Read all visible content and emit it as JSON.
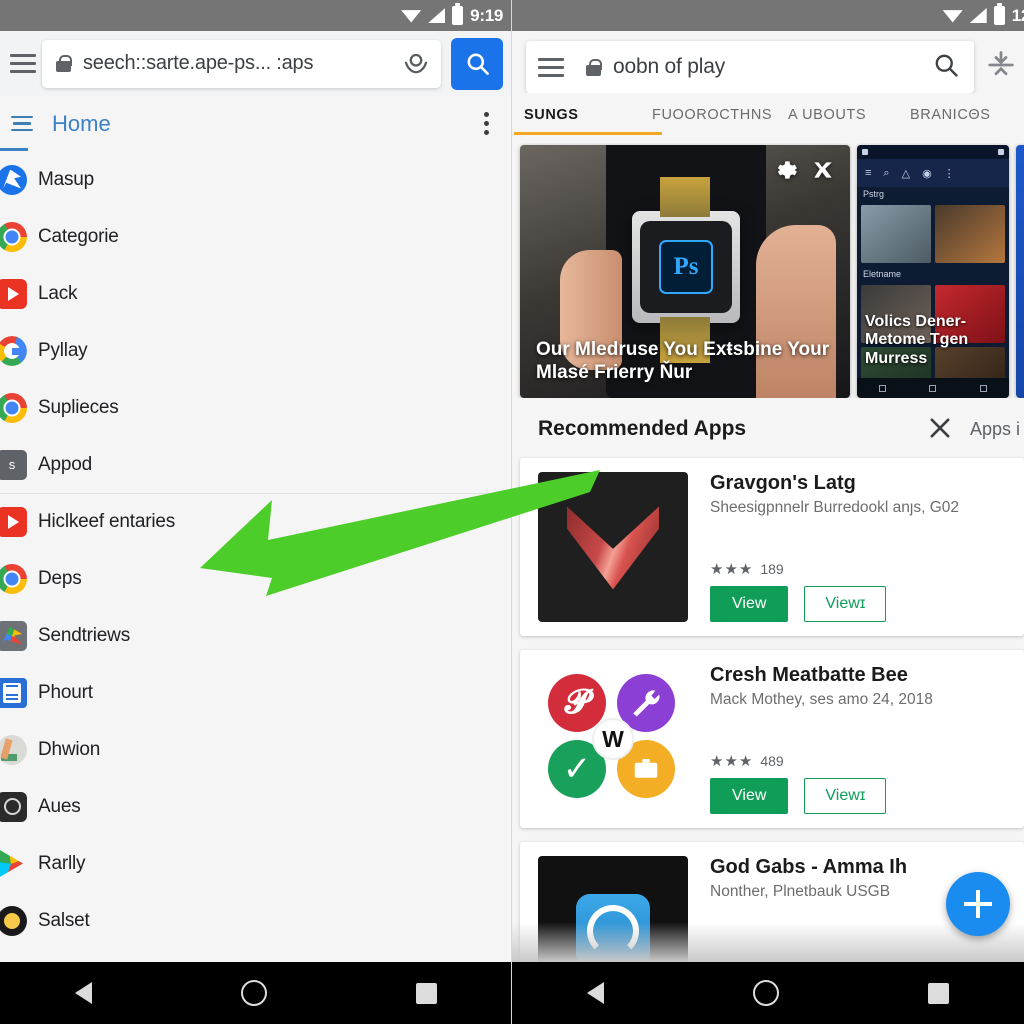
{
  "left": {
    "status": {
      "time": "9:19",
      "icons": [
        "wifi-icon",
        "signal-icon",
        "battery-icon"
      ]
    },
    "omnibox": {
      "url": "seech::sarte.ape-ps... :aps",
      "lock_icon": "lock-icon",
      "download_icon": "download-icon",
      "search_button_icon": "search-icon"
    },
    "home_header": {
      "title": "Home",
      "menu_icon": "hamburger-icon",
      "overflow_icon": "overflow-menu-icon"
    },
    "nav_items": [
      {
        "label": "Masup",
        "icon": "blue-circle-app-icon"
      },
      {
        "label": "Categorie",
        "icon": "chrome-icon"
      },
      {
        "label": "Lack",
        "icon": "youtube-icon"
      },
      {
        "label": "Pyllay",
        "icon": "google-g-icon"
      },
      {
        "label": "Suplieces",
        "icon": "chrome-icon"
      },
      {
        "label": "Appod",
        "icon": "gray-s-icon"
      },
      {
        "label": "Ηiclkeef entaries",
        "icon": "youtube-icon"
      },
      {
        "label": "Deps",
        "icon": "chrome-icon"
      },
      {
        "label": "Sendtriews",
        "icon": "photos-gray-icon"
      },
      {
        "label": "Phourt",
        "icon": "news-icon"
      },
      {
        "label": "Dhwion",
        "icon": "pale-circle-icon"
      },
      {
        "label": "Aues",
        "icon": "dark-square-icon"
      },
      {
        "label": "Rarlly",
        "icon": "play-store-icon"
      },
      {
        "label": "Salset",
        "icon": "black-ring-icon"
      }
    ]
  },
  "right": {
    "status": {
      "time": "12",
      "icons": [
        "wifi-icon",
        "signal-icon",
        "battery-icon"
      ]
    },
    "searchbar": {
      "query": "oobn of play",
      "menu_icon": "hamburger-icon",
      "lock_icon": "lock-icon",
      "search_icon": "search-icon",
      "trailing_icon": "collapse-icon"
    },
    "tabs": [
      {
        "label": "SUNGS",
        "active": true
      },
      {
        "label": "FUOOROCTHNS",
        "active": false
      },
      {
        "label": "A UBOUTS",
        "active": false
      },
      {
        "label": "BRANICΘS",
        "active": false
      }
    ],
    "carousel": [
      {
        "caption": "Our Mledruse You Exŧsbine Your Mlasé Frierry Ňur",
        "badge_icons": [
          "gear-icon",
          "shuffle-icon"
        ],
        "app_logo_text": "Ps"
      },
      {
        "caption": "Volics Dener- Metome Tgen Murress",
        "header_label": "Pstrg",
        "section_label": "Eletname"
      }
    ],
    "recommended": {
      "title": "Recommended Apps",
      "close_icon": "close-icon",
      "right_label": "Apps i"
    },
    "apps": [
      {
        "name": "Gravgon's Latg",
        "subtitle": "Sheesigpnnelr Burredookl anȷs, G02",
        "stars": "★★★",
        "rating_count": "189",
        "primary_button": "View",
        "secondary_button": "Viewɪ",
        "thumb": "dark-chevron-icon"
      },
      {
        "name": "Cresh Meatbatte Bee",
        "subtitle": "Mack Mothey, ses amo 24, 2018",
        "stars": "★★★",
        "rating_count": "489",
        "primary_button": "View",
        "secondary_button": "Viewɪ",
        "thumb": "four-circles-icon"
      },
      {
        "name": "God Gabs - Amma Ih",
        "subtitle": "Nonther, Plnetbauk USGB",
        "stars": "",
        "rating_count": "",
        "primary_button": "",
        "secondary_button": "",
        "thumb": "blue-rounded-app-icon"
      }
    ],
    "fab_icon": "add-icon"
  },
  "navbar": {
    "back_icon": "back-triangle-icon",
    "home_icon": "home-circle-icon",
    "recents_icon": "recents-square-icon"
  },
  "annotation": {
    "arrow_icon": "green-arrow-icon",
    "color": "#4ccd2a"
  }
}
